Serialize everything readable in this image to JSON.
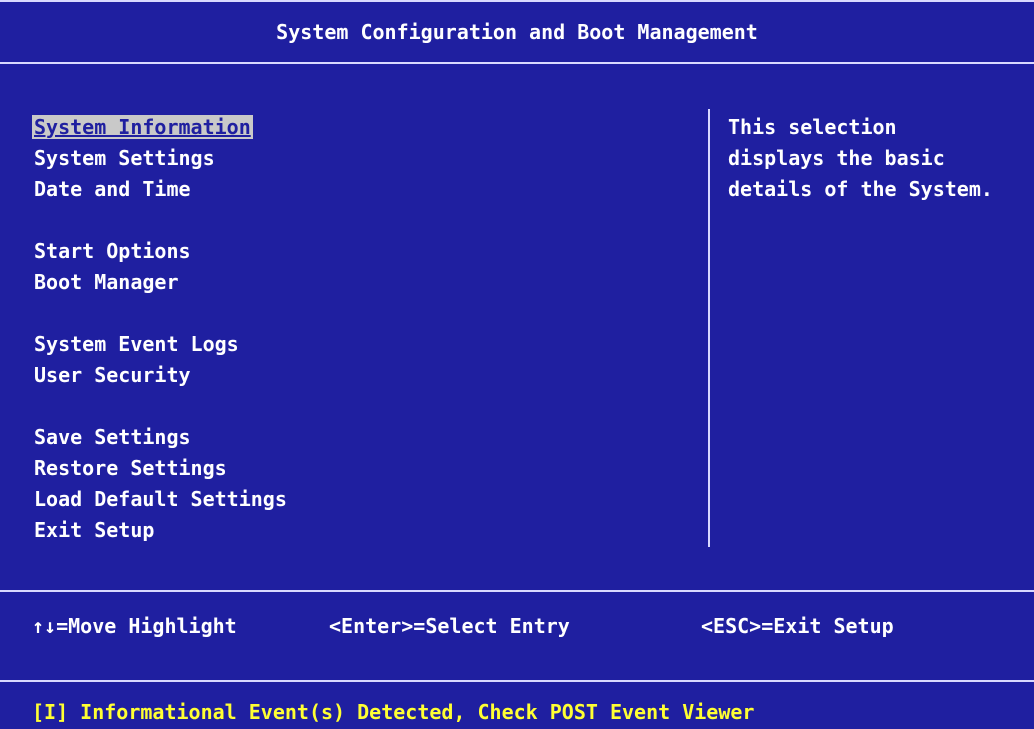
{
  "header": {
    "title": "System Configuration and Boot Management"
  },
  "menu": {
    "selected_index": 0,
    "groups": [
      [
        "System Information",
        "System Settings",
        "Date and Time"
      ],
      [
        "Start Options",
        "Boot Manager"
      ],
      [
        "System Event Logs",
        "User Security"
      ],
      [
        "Save Settings",
        "Restore Settings",
        "Load Default Settings",
        "Exit Setup"
      ]
    ]
  },
  "help": {
    "lines": [
      "This selection",
      "displays the basic",
      "details of the System."
    ]
  },
  "key_bar": {
    "move": "↑↓=Move Highlight",
    "select": "<Enter>=Select Entry",
    "exit": "<ESC>=Exit Setup"
  },
  "status": {
    "message": "[I] Informational Event(s) Detected, Check POST Event Viewer"
  },
  "colors": {
    "background": "#1f1fa0",
    "text": "#ffffff",
    "highlight_bg": "#c9c9c9",
    "status_text": "#ffff33"
  }
}
